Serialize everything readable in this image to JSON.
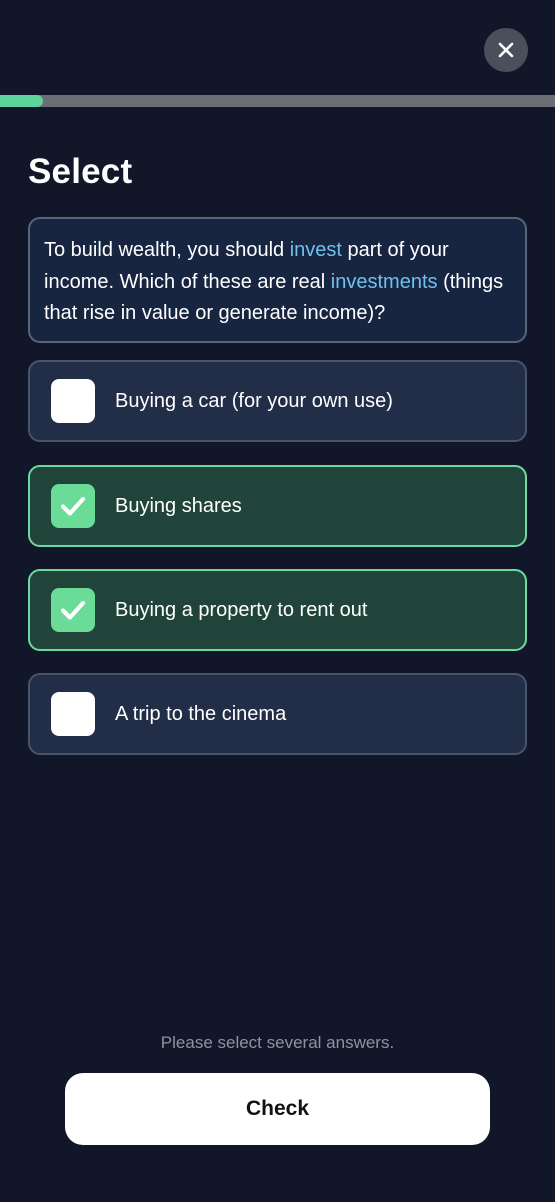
{
  "header": {
    "close_icon": "close-icon",
    "progress_fraction": 0.078,
    "accent_color": "#5ed39a"
  },
  "title": "Select",
  "question": {
    "part1": "To build wealth, you should ",
    "highlight1": "invest",
    "part2": " part of your income. Which of these are real ",
    "highlight2": "investments",
    "part3": " (things that rise in value or generate income)?",
    "highlight_color": "#6ec0ee"
  },
  "options": [
    {
      "label": "Buying a car (for your own use)",
      "selected": false
    },
    {
      "label": "Buying shares",
      "selected": true
    },
    {
      "label": "Buying a property to rent out",
      "selected": true
    },
    {
      "label": "A trip to the cinema",
      "selected": false
    }
  ],
  "hint": "Please select several answers.",
  "check_label": "Check"
}
